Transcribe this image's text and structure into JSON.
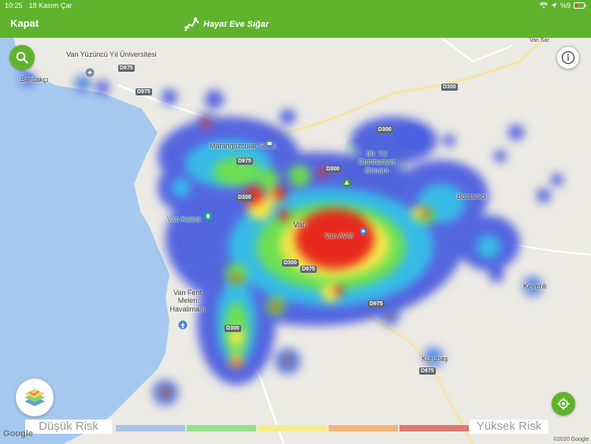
{
  "status_bar": {
    "time": "10:25",
    "date": "18 Kasım Çar",
    "battery": "%9",
    "icons": [
      "wifi-icon",
      "location-arrow-icon",
      "battery-icon"
    ]
  },
  "header": {
    "close_label": "Kapat",
    "brand": "Hayat Eve Sığar",
    "background": "#5fb32c"
  },
  "map": {
    "places": {
      "university": "Van Yüzüncü Yıl Üniversitesi",
      "bardakci": "Bardakçı",
      "marangozcular": "Marangozcular Sitesi",
      "ormani": "80. Yıl Cumhuriyet Ormanı",
      "bostaniçi": "Bostaniçi",
      "van_kalesi": "Van Kalesi",
      "van": "Van",
      "van_avm": "Van AVM",
      "airport": "Van Ferit Melen Havalimanı",
      "kevenli": "Kevenli",
      "kurubas": "Kurubaş",
      "van_sar": "Van Sar"
    },
    "roads": [
      "D975",
      "D975",
      "D300",
      "D300",
      "D975",
      "D300",
      "D300",
      "D975",
      "D975",
      "D300",
      "D975",
      "D300"
    ],
    "colors": {
      "water": "#a5c9ee",
      "land": "#eceae4",
      "park": "#cfe5c4",
      "road_major": "#f7e4a0"
    }
  },
  "buttons": {
    "search_icon": "search-icon",
    "info_icon": "info-icon",
    "layers_icon": "map-layers-icon",
    "locate_icon": "location-target-icon"
  },
  "legend": {
    "low_label": "Düşük Risk",
    "high_label": "Yüksek Risk",
    "colors": [
      "#a9c4e4",
      "#93e08f",
      "#f3ee8a",
      "#f2b47e",
      "#e07870"
    ]
  },
  "attribution": {
    "logo": "Google",
    "copyright": "©2020 Google"
  }
}
